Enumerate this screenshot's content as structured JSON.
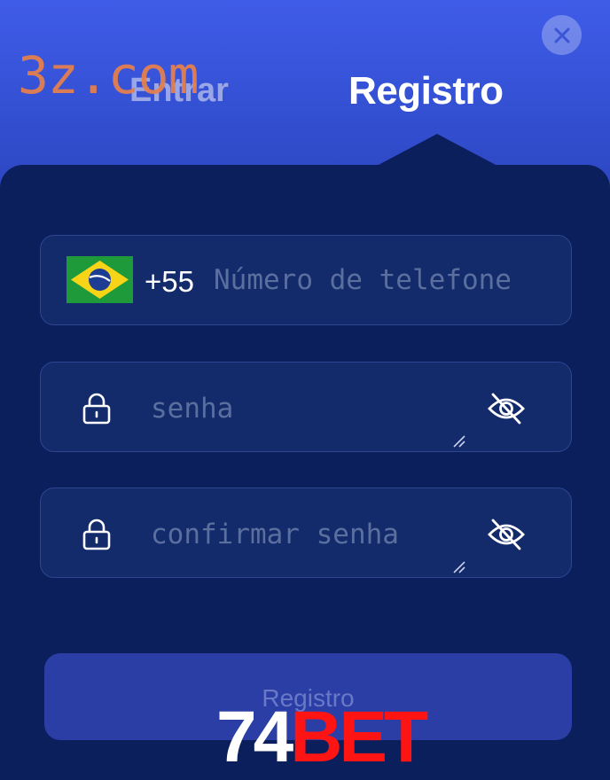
{
  "watermark": "3z.com",
  "tabs": {
    "login": "Entrar",
    "register": "Registro"
  },
  "phone": {
    "country": "Brazil",
    "dial_code": "+55",
    "placeholder": "Número de telefone"
  },
  "password": {
    "placeholder": "senha"
  },
  "confirm_password": {
    "placeholder": "confirmar senha"
  },
  "submit": {
    "label": "Registro"
  },
  "brand": {
    "number": "74",
    "text": "BET"
  },
  "icons": {
    "close": "close-icon",
    "flag": "brazil-flag-icon",
    "lock": "lock-icon",
    "eye_off": "eye-off-icon",
    "resize": "resize-handle-icon"
  },
  "colors": {
    "header_top": "#3f5ce8",
    "panel": "#0b1f5c",
    "field": "#132a6b",
    "button": "#2a3ea6",
    "watermark": "#e8804a",
    "brand_red": "#ff1414"
  }
}
